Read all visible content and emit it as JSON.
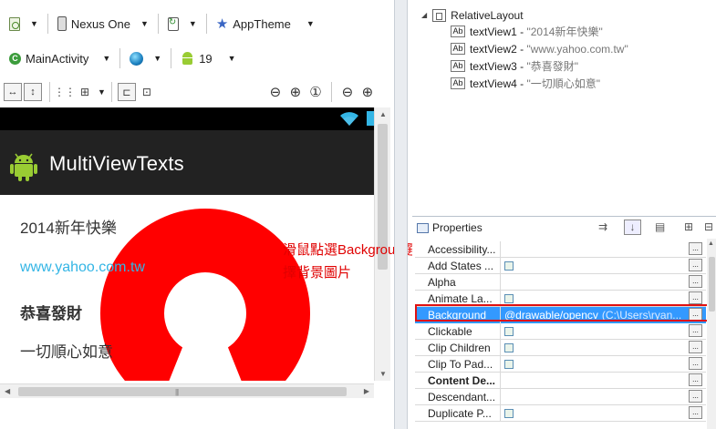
{
  "toolbar1": {
    "device_label": "Nexus One",
    "theme_label": "AppTheme"
  },
  "toolbar2": {
    "activity_label": "MainActivity",
    "api_level": "19"
  },
  "icons": {
    "config": "layout-config-icon",
    "device": "phone-icon",
    "rotate": "rotate-icon",
    "theme": "star-icon",
    "activity": "activity-icon",
    "locale": "globe-icon",
    "api": "android-icon"
  },
  "device_preview": {
    "app_title": "MultiViewTexts",
    "text_views": [
      {
        "text": "2014新年快樂"
      },
      {
        "text": "www.yahoo.com.tw"
      },
      {
        "text": "恭喜發財"
      },
      {
        "text": "一切順心如意"
      }
    ],
    "background_color": "#ff0000",
    "link_color": "#33b5e5"
  },
  "annotation": {
    "line1": "滑鼠點選Backgroud選",
    "line2": "擇背景圖片",
    "color": "#e00000"
  },
  "outline": {
    "root": "RelativeLayout",
    "children": [
      {
        "name": "textView1",
        "value": "\"2014新年快樂\""
      },
      {
        "name": "textView2",
        "value": "\"www.yahoo.com.tw\""
      },
      {
        "name": "textView3",
        "value": "\"恭喜發財\""
      },
      {
        "name": "textView4",
        "value": "\"一切順心如意\""
      }
    ]
  },
  "properties": {
    "title": "Properties",
    "rows": [
      {
        "name": "Accessibility...",
        "value": "",
        "check": false
      },
      {
        "name": "Add States ...",
        "value": "",
        "check": true
      },
      {
        "name": "Alpha",
        "value": "",
        "check": false
      },
      {
        "name": "Animate La...",
        "value": "",
        "check": true
      },
      {
        "name": "Background",
        "value": "@drawable/opencv",
        "path": "(C:\\Users\\ryan...",
        "check": false,
        "selected": true
      },
      {
        "name": "Clickable",
        "value": "",
        "check": true
      },
      {
        "name": "Clip Children",
        "value": "",
        "check": true
      },
      {
        "name": "Clip To Pad...",
        "value": "",
        "check": true
      },
      {
        "name": "Content De...",
        "value": "",
        "check": false,
        "bold": true
      },
      {
        "name": "Descendant...",
        "value": "",
        "check": false
      },
      {
        "name": "Duplicate P...",
        "value": "",
        "check": true
      }
    ],
    "ellipsis": "..."
  }
}
